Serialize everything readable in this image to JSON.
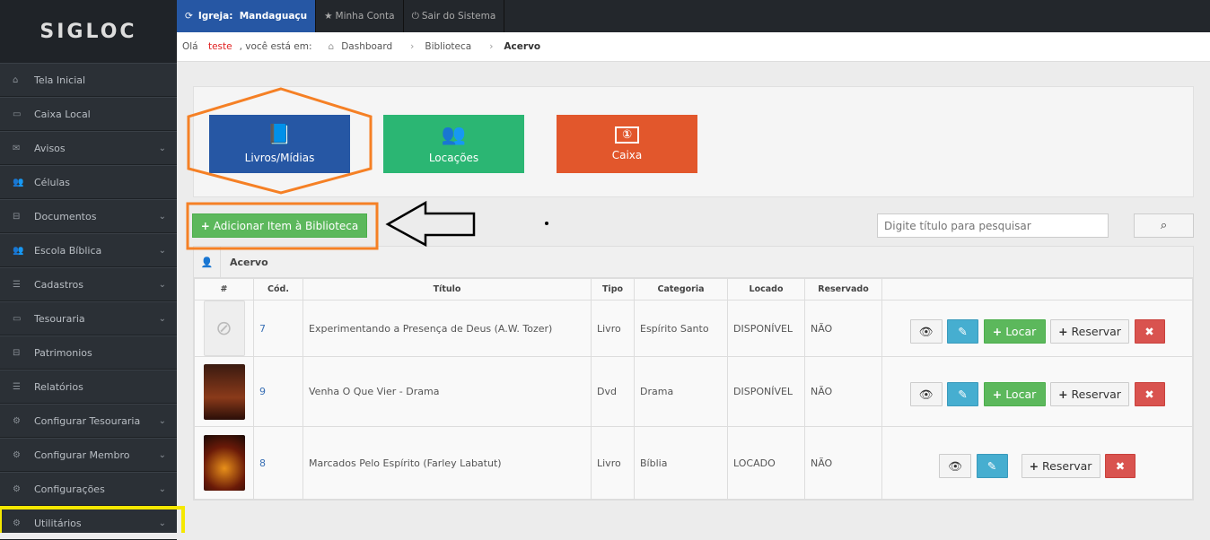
{
  "logo": "SIGLOC",
  "topbar": {
    "church": "Igreja:  Mandaguaçu",
    "account": "Minha Conta",
    "logout": "Sair do Sistema"
  },
  "breadcrumb": {
    "greeting": "Olá",
    "user": "teste",
    "suffix": ", você está em:",
    "items": [
      "Dashboard",
      "Biblioteca",
      "Acervo"
    ]
  },
  "sidebar": {
    "items": [
      {
        "label": "Tela Inicial",
        "icon": "home-icon",
        "chev": false
      },
      {
        "label": "Caixa Local",
        "icon": "money-icon",
        "chev": false
      },
      {
        "label": "Avisos",
        "icon": "envelope-icon",
        "chev": true
      },
      {
        "label": "Células",
        "icon": "users-icon",
        "chev": false
      },
      {
        "label": "Documentos",
        "icon": "inbox-icon",
        "chev": true
      },
      {
        "label": "Escola Bíblica",
        "icon": "users-icon",
        "chev": true
      },
      {
        "label": "Cadastros",
        "icon": "list-icon",
        "chev": true
      },
      {
        "label": "Tesouraria",
        "icon": "money-icon",
        "chev": true
      },
      {
        "label": "Patrimonios",
        "icon": "inbox-icon",
        "chev": false
      },
      {
        "label": "Relatórios",
        "icon": "list-icon",
        "chev": false
      },
      {
        "label": "Configurar Tesouraria",
        "icon": "gear-icon",
        "chev": true
      },
      {
        "label": "Configurar Membro",
        "icon": "gear-icon",
        "chev": true
      },
      {
        "label": "Configurações",
        "icon": "gear-icon",
        "chev": true
      },
      {
        "label": "Utilitários",
        "icon": "gear-icon",
        "chev": true
      }
    ]
  },
  "tiles": [
    {
      "label": "Livros/Mídias",
      "color": "#2657a4"
    },
    {
      "label": "Locações",
      "color": "#2bb673"
    },
    {
      "label": "Caixa",
      "color": "#e2572c"
    }
  ],
  "add_button": "Adicionar Item à Biblioteca",
  "search": {
    "placeholder": "Digite título para pesquisar"
  },
  "table": {
    "title": "Acervo",
    "columns": [
      "#",
      "Cód.",
      "Título",
      "Tipo",
      "Categoria",
      "Locado",
      "Reservado"
    ],
    "rows": [
      {
        "cod": "7",
        "titulo": "Experimentando a Presença de Deus (A.W. Tozer)",
        "tipo": "Livro",
        "categoria": "Espírito Santo",
        "locado": "DISPONÍVEL",
        "reservado": "NÃO",
        "can_rent": true
      },
      {
        "cod": "9",
        "titulo": "Venha O Que Vier - Drama",
        "tipo": "Dvd",
        "categoria": "Drama",
        "locado": "DISPONÍVEL",
        "reservado": "NÃO",
        "can_rent": true
      },
      {
        "cod": "8",
        "titulo": "Marcados Pelo Espírito (Farley Labatut)",
        "tipo": "Livro",
        "categoria": "Bíblia",
        "locado": "LOCADO",
        "reservado": "NÃO",
        "can_rent": false
      }
    ],
    "actions": {
      "rent": "Locar",
      "reserve": "Reservar"
    }
  }
}
